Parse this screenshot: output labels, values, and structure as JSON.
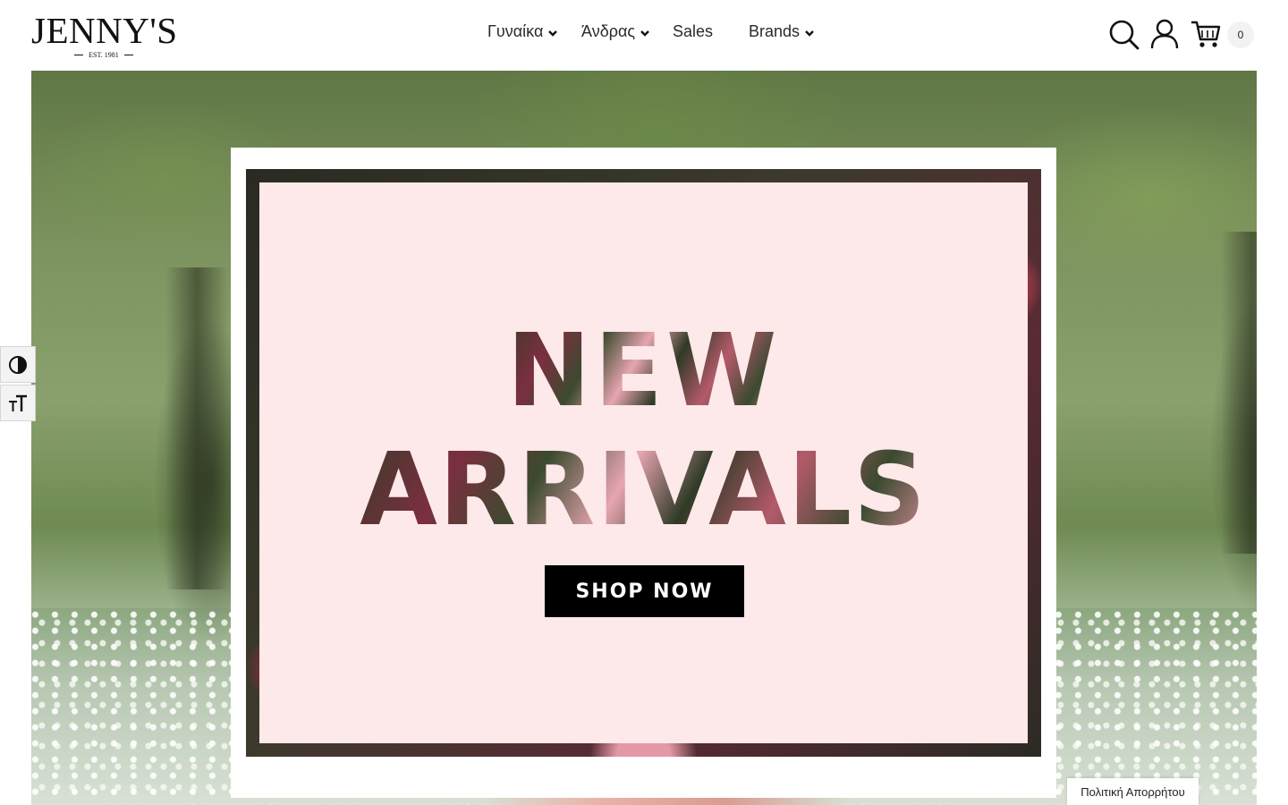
{
  "brand": {
    "name": "JENNY'S",
    "tagline": "EST. 1981"
  },
  "nav": {
    "items": [
      {
        "label": "Γυναίκα",
        "has_dropdown": true
      },
      {
        "label": "Άνδρας",
        "has_dropdown": true
      },
      {
        "label": "Sales",
        "has_dropdown": false
      },
      {
        "label": "Brands",
        "has_dropdown": true
      }
    ]
  },
  "header_icons": {
    "search": "search-icon",
    "account": "user-icon",
    "cart": "cart-icon",
    "cart_count": "0"
  },
  "hero": {
    "headline_line1": "NEW",
    "headline_line2": "ARRIVALS",
    "cta_label": "SHOP NOW"
  },
  "accessibility": {
    "contrast_icon": "contrast-icon",
    "font_size_icon": "font-size-icon"
  },
  "footer_tab": {
    "privacy_label": "Πολιτική Απορρήτου"
  },
  "colors": {
    "header_bg": "#ffffff",
    "banner_bg": "#fde8ea",
    "cta_bg": "#000000",
    "cta_text": "#ffffff"
  }
}
